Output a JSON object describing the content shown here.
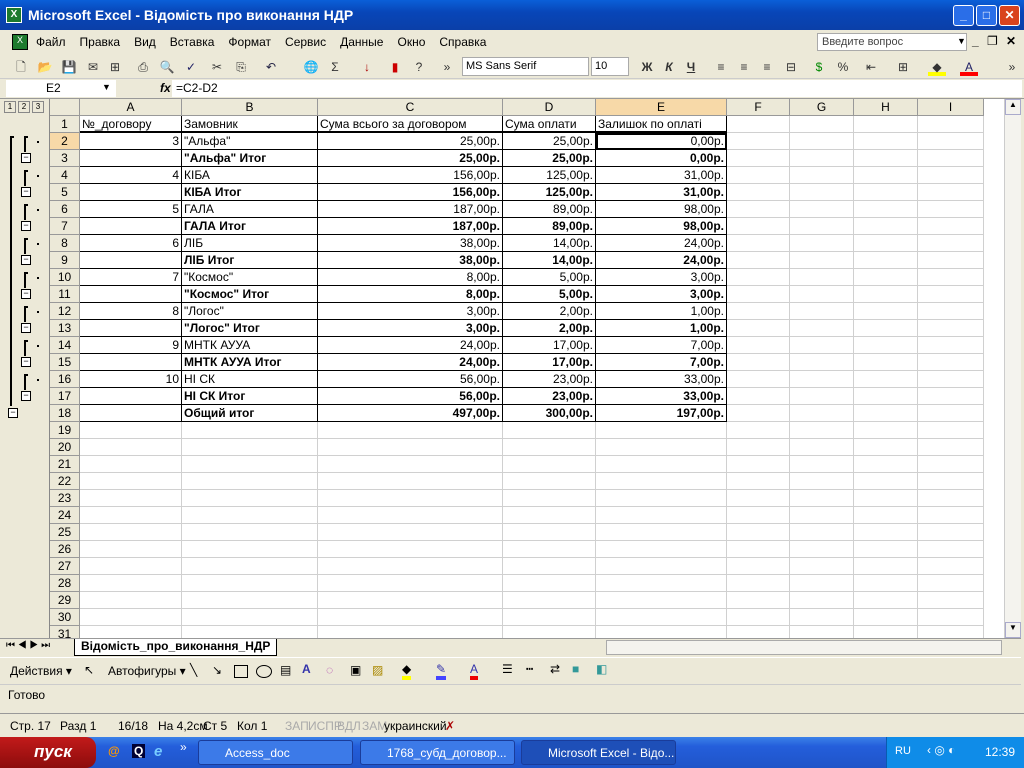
{
  "window": {
    "title": "Microsoft Excel - Відомість про виконання НДР"
  },
  "menu": [
    "Файл",
    "Правка",
    "Вид",
    "Вставка",
    "Формат",
    "Сервис",
    "Данные",
    "Окно",
    "Справка"
  ],
  "help_placeholder": "Введите вопрос",
  "toolbar": {
    "font": "MS Sans Serif",
    "size": "10",
    "bold": "Ж",
    "italic": "К",
    "underline": "Ч",
    "percent": "%",
    "sum": "Σ"
  },
  "formula_bar": {
    "name_box": "E2",
    "fx": "fx",
    "formula": "=C2-D2"
  },
  "outline_levels": [
    "1",
    "2",
    "3"
  ],
  "columns": [
    "A",
    "B",
    "C",
    "D",
    "E",
    "F",
    "G",
    "H",
    "I"
  ],
  "rows": [
    [
      "№_договору",
      "Замовник",
      "Сума всього за договором",
      "Сума оплати",
      "Залишок по оплаті",
      0
    ],
    [
      "3",
      "\"Альфа\"",
      "25,00р.",
      "25,00р.",
      "0,00р.",
      0
    ],
    [
      "",
      "\"Альфа\" Итог",
      "25,00р.",
      "25,00р.",
      "0,00р.",
      1
    ],
    [
      "4",
      "КІБА",
      "156,00р.",
      "125,00р.",
      "31,00р.",
      0
    ],
    [
      "",
      "КІБА Итог",
      "156,00р.",
      "125,00р.",
      "31,00р.",
      1
    ],
    [
      "5",
      "ГАЛА",
      "187,00р.",
      "89,00р.",
      "98,00р.",
      0
    ],
    [
      "",
      "ГАЛА Итог",
      "187,00р.",
      "89,00р.",
      "98,00р.",
      1
    ],
    [
      "6",
      "ЛІБ",
      "38,00р.",
      "14,00р.",
      "24,00р.",
      0
    ],
    [
      "",
      "ЛІБ Итог",
      "38,00р.",
      "14,00р.",
      "24,00р.",
      1
    ],
    [
      "7",
      "\"Космос\"",
      "8,00р.",
      "5,00р.",
      "3,00р.",
      0
    ],
    [
      "",
      "\"Космос\" Итог",
      "8,00р.",
      "5,00р.",
      "3,00р.",
      1
    ],
    [
      "8",
      "\"Логос\"",
      "3,00р.",
      "2,00р.",
      "1,00р.",
      0
    ],
    [
      "",
      "\"Логос\" Итог",
      "3,00р.",
      "2,00р.",
      "1,00р.",
      1
    ],
    [
      "9",
      "МНТК АУУА",
      "24,00р.",
      "17,00р.",
      "7,00р.",
      0
    ],
    [
      "",
      "МНТК АУУА Итог",
      "24,00р.",
      "17,00р.",
      "7,00р.",
      1
    ],
    [
      "10",
      "НІ СК",
      "56,00р.",
      "23,00р.",
      "33,00р.",
      0
    ],
    [
      "",
      "НІ СК Итог",
      "56,00р.",
      "23,00р.",
      "33,00р.",
      1
    ],
    [
      "",
      "Общий итог",
      "497,00р.",
      "300,00р.",
      "197,00р.",
      1
    ]
  ],
  "sheet_tab": "Відомість_про_виконання_НДР",
  "drawing": {
    "actions": "Действия ▾",
    "autoshapes": "Автофигуры ▾"
  },
  "status": "Готово",
  "word_status": [
    "Стр. 17",
    "Разд 1",
    "16/18",
    "На 4,2см",
    "Ст 5",
    "Кол 1",
    "ЗАП",
    "ИСПР",
    "ВДЛ",
    "ЗАМ",
    "украинский"
  ],
  "taskbar": {
    "start": "пуск",
    "tasks": [
      "Access_doc",
      "1768_субд_договор...",
      "Microsoft Excel - Відо..."
    ],
    "lang": "RU",
    "clock": "12:39"
  }
}
